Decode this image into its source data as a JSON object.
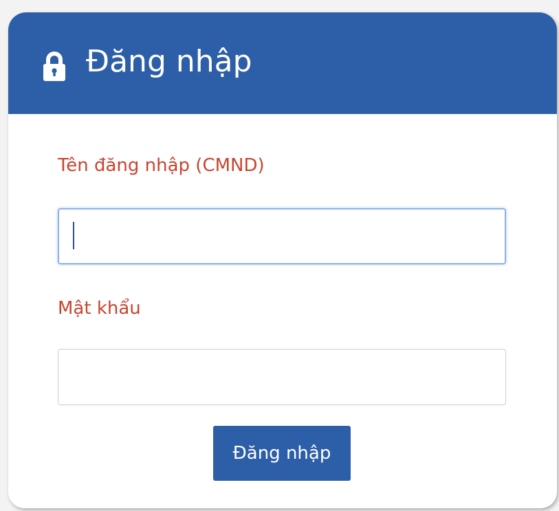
{
  "header": {
    "title": "Đăng nhập",
    "icon": "lock-icon"
  },
  "form": {
    "username_label": "Tên đăng nhập (CMND)",
    "username_value": "",
    "password_label": "Mật khẩu",
    "password_value": "",
    "submit_label": "Đăng nhập"
  },
  "colors": {
    "header_bg": "#2d5ea8",
    "label_color": "#c9442e",
    "button_bg": "#2d5ea8",
    "focus_border": "#8eaff0"
  }
}
